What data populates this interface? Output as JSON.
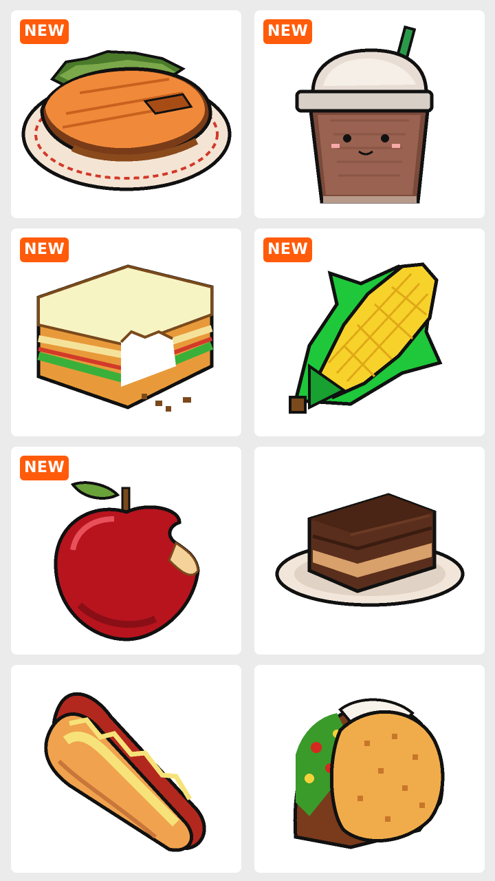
{
  "badge_text": "NEW",
  "colors": {
    "background": "#ebebeb",
    "card": "#ffffff",
    "badge": "#ff5b0a"
  },
  "items": [
    {
      "name": "salmon-steak-icon",
      "is_new": true
    },
    {
      "name": "iced-coffee-icon",
      "is_new": true
    },
    {
      "name": "sandwich-icon",
      "is_new": true
    },
    {
      "name": "corn-icon",
      "is_new": true
    },
    {
      "name": "apple-icon",
      "is_new": true
    },
    {
      "name": "brownie-icon",
      "is_new": false
    },
    {
      "name": "hot-dog-icon",
      "is_new": false
    },
    {
      "name": "taco-icon",
      "is_new": false
    }
  ]
}
